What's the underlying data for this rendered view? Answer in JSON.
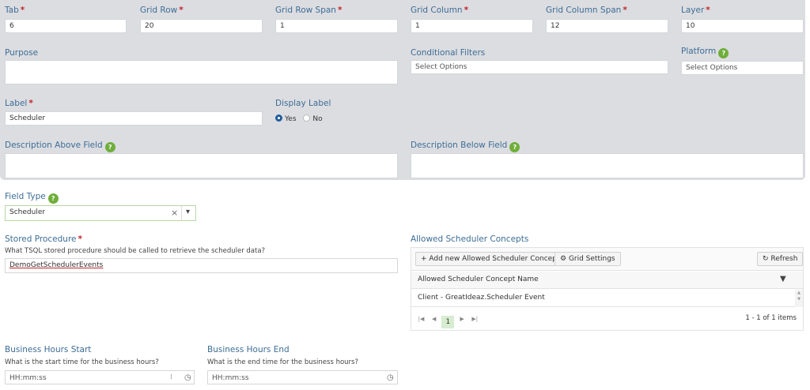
{
  "row1": [
    {
      "label": "Tab",
      "value": "6"
    },
    {
      "label": "Grid Row",
      "value": "20"
    },
    {
      "label": "Grid Row Span",
      "value": "1"
    },
    {
      "label": "Grid Column",
      "value": "1"
    },
    {
      "label": "Grid Column Span",
      "value": "12"
    },
    {
      "label": "Layer",
      "value": "10"
    }
  ],
  "required_mark": "*",
  "help_glyph": "?",
  "purpose": {
    "label": "Purpose"
  },
  "conditional_filters": {
    "label": "Conditional Filters",
    "placeholder": "Select Options"
  },
  "platform": {
    "label": "Platform",
    "placeholder": "Select Options"
  },
  "label_field": {
    "label": "Label",
    "value": "Scheduler"
  },
  "display_label": {
    "label": "Display Label",
    "yes": "Yes",
    "no": "No",
    "selected": "Yes"
  },
  "desc_above": {
    "label": "Description Above Field"
  },
  "desc_below": {
    "label": "Description Below Field"
  },
  "field_type": {
    "label": "Field Type",
    "value": "Scheduler",
    "clear": "×",
    "caret": "▾"
  },
  "stored_procedure": {
    "label": "Stored Procedure",
    "help": "What TSQL stored procedure should be called to retrieve the scheduler data?",
    "value": "DemoGetSchedulerEvents"
  },
  "concepts": {
    "title": "Allowed Scheduler Concepts",
    "add_button": "+ Add new Allowed Scheduler Concept",
    "grid_settings": "Grid Settings",
    "refresh": "Refresh",
    "column": "Allowed Scheduler Concept Name",
    "rows": [
      "Client - GreatIdeaz.Scheduler Event"
    ],
    "page": "1",
    "summary": "1 - 1 of 1 items"
  },
  "bh_start": {
    "label": "Business Hours Start",
    "help": "What is the start time for the business hours?",
    "placeholder": "HH:mm:ss"
  },
  "bh_end": {
    "label": "Business Hours End",
    "help": "What is the end time for the business hours?",
    "placeholder": "HH:mm:ss"
  },
  "colors": {
    "panel": "#dcdde1",
    "label": "#3d6d95",
    "required": "#c0262d",
    "help": "#6fae3a",
    "radio": "#1f5d9c"
  }
}
